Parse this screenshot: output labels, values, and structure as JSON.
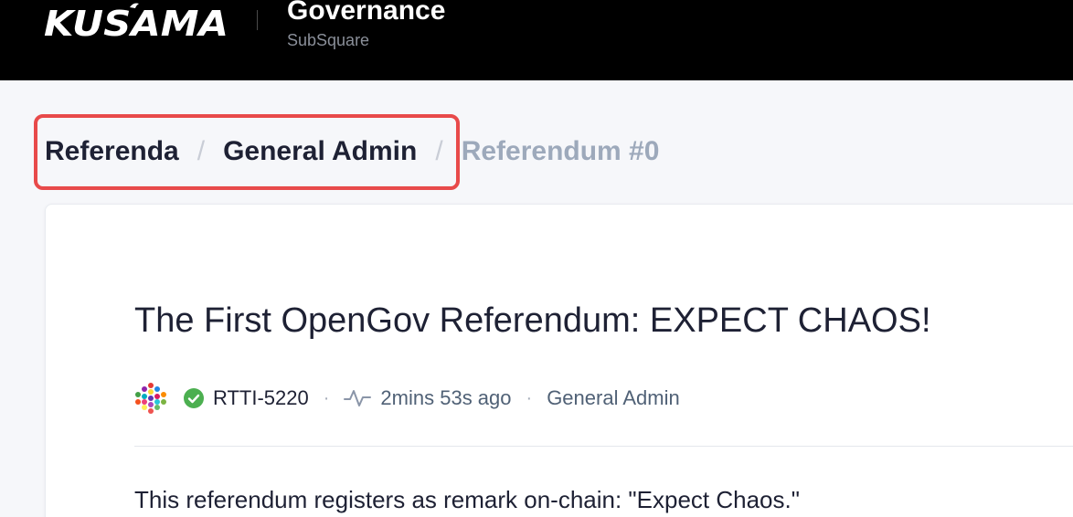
{
  "header": {
    "logo_alt": "KUSAMA",
    "title": "Governance",
    "subtitle": "SubSquare"
  },
  "breadcrumb": {
    "items": [
      "Referenda",
      "General Admin"
    ],
    "separator": "/",
    "current": "Referendum #0"
  },
  "post": {
    "title": "The First OpenGov Referendum: EXPECT CHAOS!",
    "author": "RTTI-5220",
    "time": "2mins 53s ago",
    "track": "General Admin",
    "meta_separator": "·",
    "body": "This referendum registers as remark on-chain: \"Expect Chaos.\""
  },
  "icons": {
    "avatar": "identicon-avatar",
    "verified": "check-circle-icon",
    "activity": "activity-pulse-icon"
  },
  "colors": {
    "header_bg": "#000000",
    "highlight": "#e84a4a",
    "verified_green": "#4caf50",
    "text_primary": "#1e2134",
    "text_muted": "#9da9bb"
  }
}
